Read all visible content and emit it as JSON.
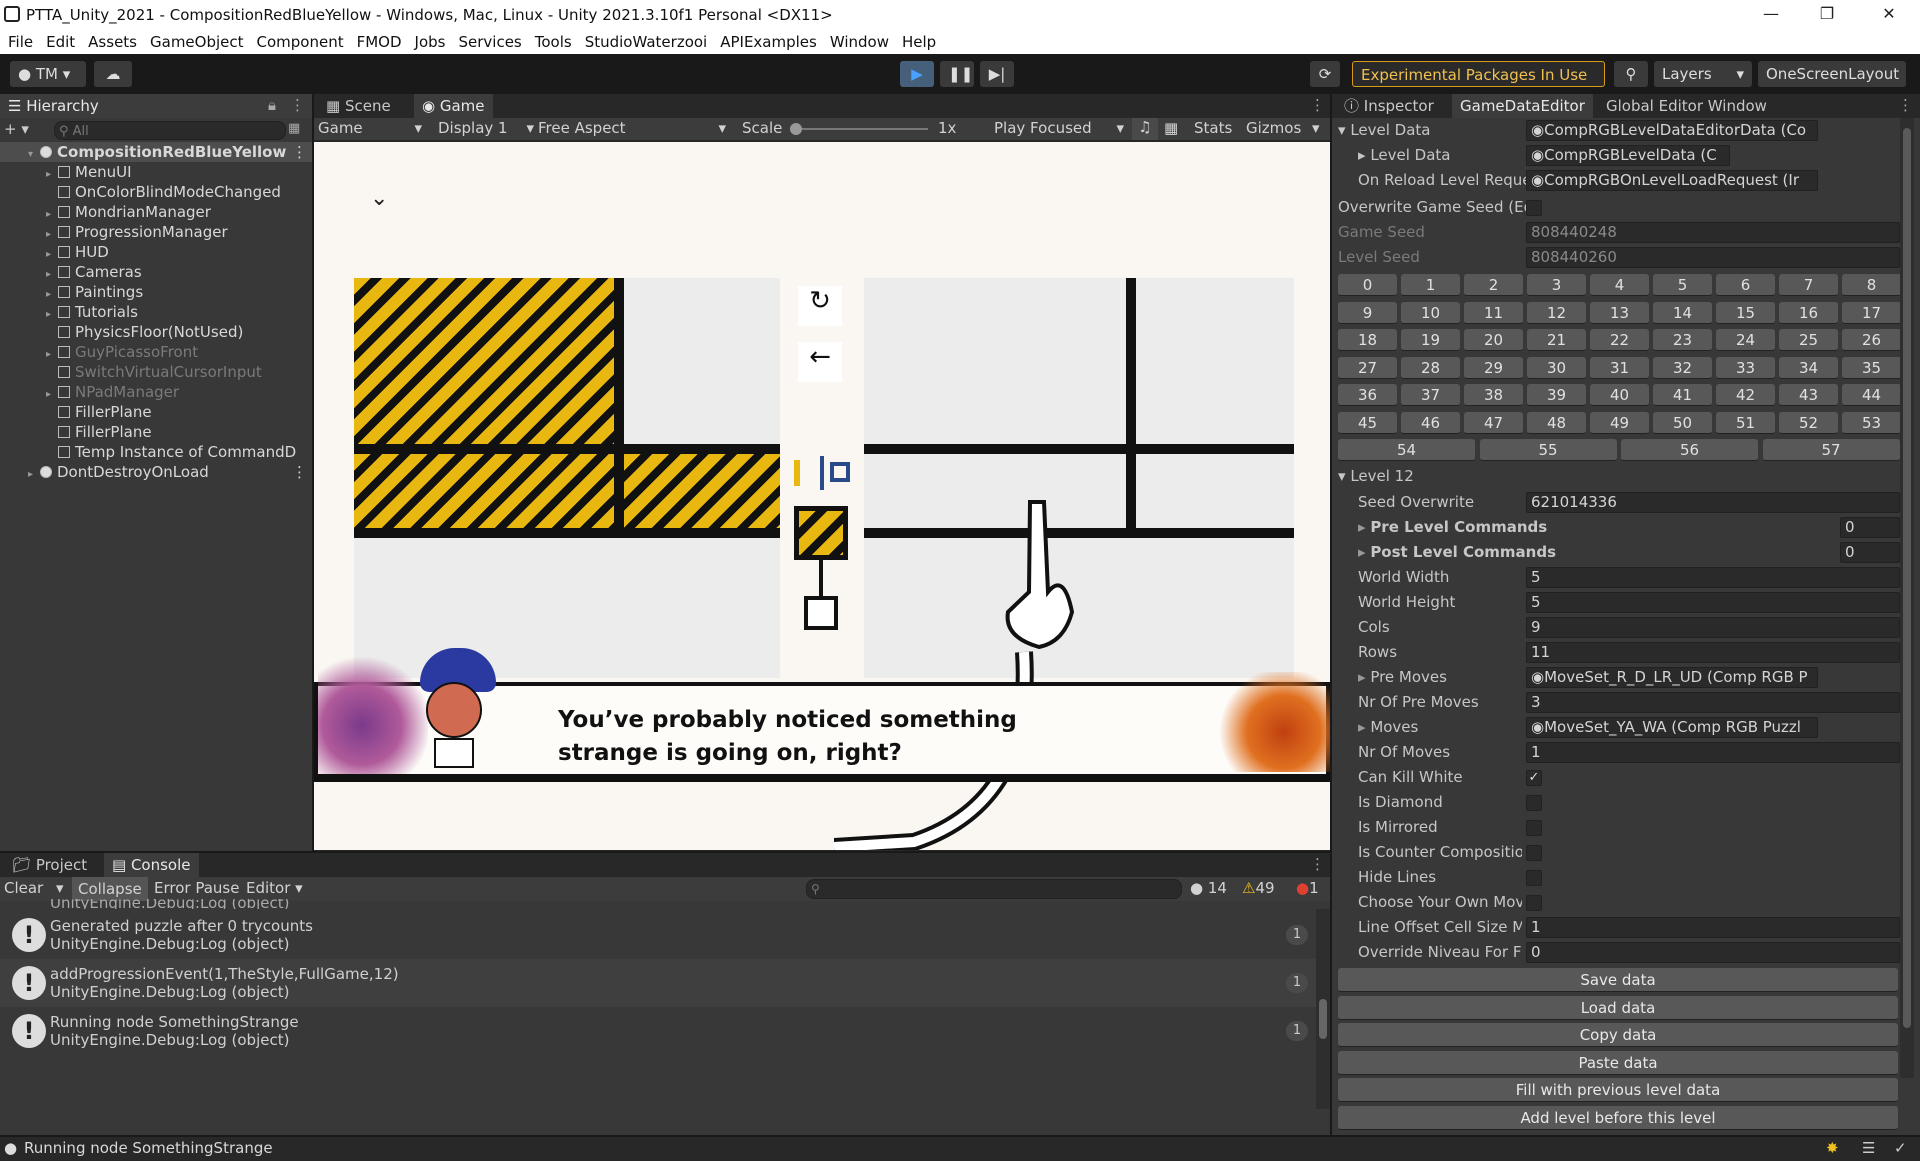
{
  "window": {
    "title": "PTTA_Unity_2021 - CompositionRedBlueYellow - Windows, Mac, Linux - Unity 2021.3.10f1 Personal <DX11>"
  },
  "menu": [
    "File",
    "Edit",
    "Assets",
    "GameObject",
    "Component",
    "FMOD",
    "Jobs",
    "Services",
    "Tools",
    "StudioWaterzooi",
    "APIExamples",
    "Window",
    "Help"
  ],
  "toolbar": {
    "account": "TM",
    "experimental": "Experimental Packages In Use",
    "layers": "Layers",
    "layout": "OneScreenLayout"
  },
  "hierarchy": {
    "tab": "Hierarchy",
    "search_placeholder": "All",
    "items": [
      {
        "label": "CompositionRedBlueYellow",
        "level": 0,
        "dim": false,
        "selected": true
      },
      {
        "label": "MenuUI",
        "level": 1,
        "dim": false
      },
      {
        "label": "OnColorBlindModeChanged",
        "level": 1,
        "dim": false
      },
      {
        "label": "MondrianManager",
        "level": 1,
        "dim": false
      },
      {
        "label": "ProgressionManager",
        "level": 1,
        "dim": false
      },
      {
        "label": "HUD",
        "level": 1,
        "dim": false
      },
      {
        "label": "Cameras",
        "level": 1,
        "dim": false
      },
      {
        "label": "Paintings",
        "level": 1,
        "dim": false
      },
      {
        "label": "Tutorials",
        "level": 1,
        "dim": false
      },
      {
        "label": "PhysicsFloor(NotUsed)",
        "level": 1,
        "dim": false
      },
      {
        "label": "GuyPicassoFront",
        "level": 1,
        "dim": true
      },
      {
        "label": "SwitchVirtualCursorInput",
        "level": 1,
        "dim": true
      },
      {
        "label": "NPadManager",
        "level": 1,
        "dim": true
      },
      {
        "label": "FillerPlane",
        "level": 1,
        "dim": false
      },
      {
        "label": "FillerPlane",
        "level": 1,
        "dim": false
      },
      {
        "label": "Temp Instance of CommandD",
        "level": 1,
        "dim": false
      },
      {
        "label": "DontDestroyOnLoad",
        "level": 0,
        "dim": false
      }
    ]
  },
  "scene": {
    "tabs": [
      "Scene",
      "Game"
    ],
    "game_dropdown": "Game",
    "display": "Display 1",
    "aspect": "Free Aspect",
    "scale_label": "Scale",
    "scale_value": "1x",
    "play_focused": "Play Focused",
    "stats": "Stats",
    "gizmos": "Gizmos"
  },
  "game": {
    "dialog": "You’ve probably noticed something strange is going on, right?"
  },
  "console": {
    "tabs": [
      "Project",
      "Console"
    ],
    "clear": "Clear",
    "collapse": "Collapse",
    "error_pause": "Error Pause",
    "editor": "Editor",
    "count_info": "14",
    "count_warn": "49",
    "count_err": "1",
    "logs": [
      {
        "line1": "Generated puzzle after 0 trycounts",
        "line2": "UnityEngine.Debug:Log (object)",
        "count": "1"
      },
      {
        "line1": "addProgressionEvent(1,TheStyle,FullGame,12)",
        "line2": "UnityEngine.Debug:Log (object)",
        "count": "1"
      },
      {
        "line1": "Running node SomethingStrange",
        "line2": "UnityEngine.Debug:Log (object)",
        "count": "1"
      }
    ],
    "partial": "UnityEngine.Debug:Log (object)"
  },
  "inspector": {
    "tabs": [
      "Inspector",
      "GameDataEditor",
      "Global Editor Window"
    ],
    "level_data_label": "Level Data",
    "level_data_value": "CompRGBLevelDataEditorData (Co",
    "level_data_inner": "Level Data",
    "level_data_inner_value": "CompRGBLevelData (C",
    "on_reload": "On Reload Level Reque",
    "on_reload_value": "CompRGBOnLevelLoadRequest (Ir",
    "overwrite_seed": "Overwrite Game Seed (Edi",
    "game_seed": "Game Seed",
    "game_seed_value": "808440248",
    "level_seed": "Level Seed",
    "level_seed_value": "808440260",
    "level_buttons": [
      "0",
      "1",
      "2",
      "3",
      "4",
      "5",
      "6",
      "7",
      "8",
      "9",
      "10",
      "11",
      "12",
      "13",
      "14",
      "15",
      "16",
      "17",
      "18",
      "19",
      "20",
      "21",
      "22",
      "23",
      "24",
      "25",
      "26",
      "27",
      "28",
      "29",
      "30",
      "31",
      "32",
      "33",
      "34",
      "35",
      "36",
      "37",
      "38",
      "39",
      "40",
      "41",
      "42",
      "43",
      "44",
      "45",
      "46",
      "47",
      "48",
      "49",
      "50",
      "51",
      "52",
      "53"
    ],
    "last_row": [
      "54",
      "55",
      "56",
      "57"
    ],
    "level_header": "Level 12",
    "fields": [
      {
        "label": "Seed Overwrite",
        "value": "621014336"
      },
      {
        "label": "Pre Level Commands",
        "value": "0",
        "bold": true
      },
      {
        "label": "Post Level Commands",
        "value": "0",
        "bold": true
      },
      {
        "label": "World Width",
        "value": "5"
      },
      {
        "label": "World Height",
        "value": "5"
      },
      {
        "label": "Cols",
        "value": "9"
      },
      {
        "label": "Rows",
        "value": "11"
      },
      {
        "label": "Pre Moves",
        "value": "MoveSet_R_D_LR_UD (Comp RGB P"
      },
      {
        "label": "Nr Of Pre Moves",
        "value": "3"
      },
      {
        "label": "Moves",
        "value": "MoveSet_YA_WA (Comp RGB Puzzl"
      },
      {
        "label": "Nr Of Moves",
        "value": "1"
      }
    ],
    "checks": [
      {
        "label": "Can Kill White",
        "checked": true
      },
      {
        "label": "Is Diamond",
        "checked": false
      },
      {
        "label": "Is Mirrored",
        "checked": false
      },
      {
        "label": "Is Counter Composition",
        "checked": false
      },
      {
        "label": "Hide Lines",
        "checked": false
      },
      {
        "label": "Choose Your Own Move",
        "checked": false
      }
    ],
    "line_offset": "Line Offset Cell Size Mu",
    "line_offset_value": "1",
    "override": "Override Niveau For FM",
    "override_value": "0",
    "buttons": [
      "Save data",
      "Load data",
      "Copy data",
      "Paste data",
      "Fill with previous level data",
      "Add level before this level"
    ]
  },
  "statusbar": {
    "text": "Running node SomethingStrange"
  }
}
